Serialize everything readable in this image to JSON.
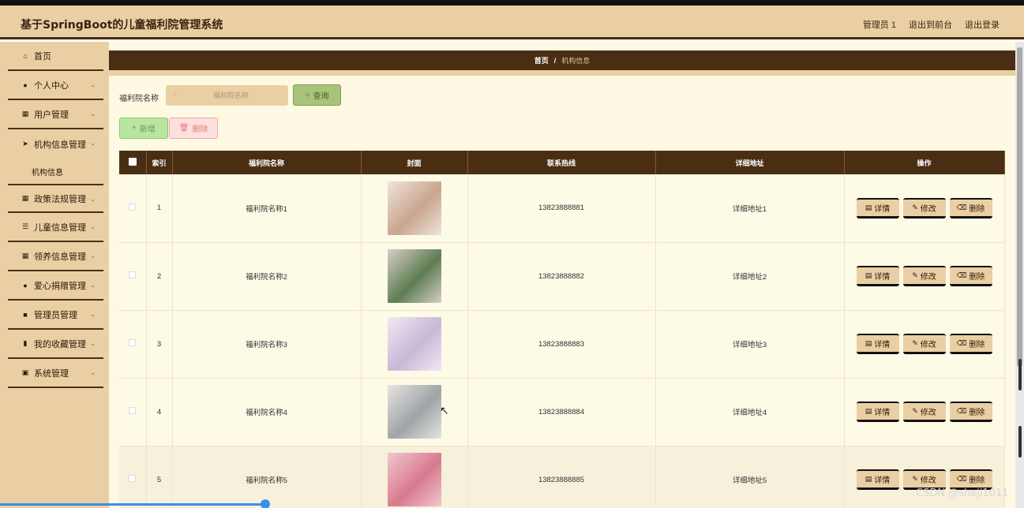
{
  "header": {
    "title": "基于SpringBoot的儿童福利院管理系统",
    "user": "管理员 1",
    "back_to_front": "退出到前台",
    "logout": "退出登录"
  },
  "sidebar": {
    "items": [
      {
        "label": "首页",
        "icon": "home-icon"
      },
      {
        "label": "个人中心",
        "icon": "user-icon"
      },
      {
        "label": "用户管理",
        "icon": "grid-icon"
      },
      {
        "label": "机构信息管理",
        "icon": "send-icon"
      },
      {
        "label": "机构信息",
        "icon": ""
      },
      {
        "label": "政策法规管理",
        "icon": "grid-icon"
      },
      {
        "label": "儿童信息管理",
        "icon": "list-icon"
      },
      {
        "label": "领养信息管理",
        "icon": "grid-icon"
      },
      {
        "label": "爱心捐赠管理",
        "icon": "user-icon"
      },
      {
        "label": "管理员管理",
        "icon": "square-icon"
      },
      {
        "label": "我的收藏管理",
        "icon": "chart-icon"
      },
      {
        "label": "系统管理",
        "icon": "clipboard-icon"
      }
    ]
  },
  "breadcrumb": {
    "home": "首页",
    "sep": "/",
    "current": "机构信息"
  },
  "search": {
    "label": "福利院名称",
    "placeholder": "福利院名称",
    "button": "查询"
  },
  "toolbar": {
    "add": "新增",
    "delete": "删除"
  },
  "table": {
    "headers": [
      "索引",
      "福利院名称",
      "封面",
      "联系热线",
      "详细地址",
      "操作"
    ],
    "rows": [
      {
        "index": "1",
        "name": "福利院名称1",
        "phone": "13823888881",
        "address": "详细地址1",
        "cover_colors": [
          "#c9a58e",
          "#efe4dc"
        ]
      },
      {
        "index": "2",
        "name": "福利院名称2",
        "phone": "13823888882",
        "address": "详细地址2",
        "cover_colors": [
          "#5f7d52",
          "#d6cfc6"
        ]
      },
      {
        "index": "3",
        "name": "福利院名称3",
        "phone": "13823888883",
        "address": "详细地址3",
        "cover_colors": [
          "#c7b8d8",
          "#f1e9f3"
        ]
      },
      {
        "index": "4",
        "name": "福利院名称4",
        "phone": "13823888884",
        "address": "详细地址4",
        "cover_colors": [
          "#9fa4a8",
          "#e6e4de"
        ]
      },
      {
        "index": "5",
        "name": "福利院名称5",
        "phone": "13823888885",
        "address": "详细地址5",
        "cover_colors": [
          "#d77a8e",
          "#f2c6cf"
        ]
      }
    ],
    "actions": {
      "detail": "详情",
      "edit": "修改",
      "delete": "删除"
    }
  },
  "watermark": "CSDN @sheji1011"
}
